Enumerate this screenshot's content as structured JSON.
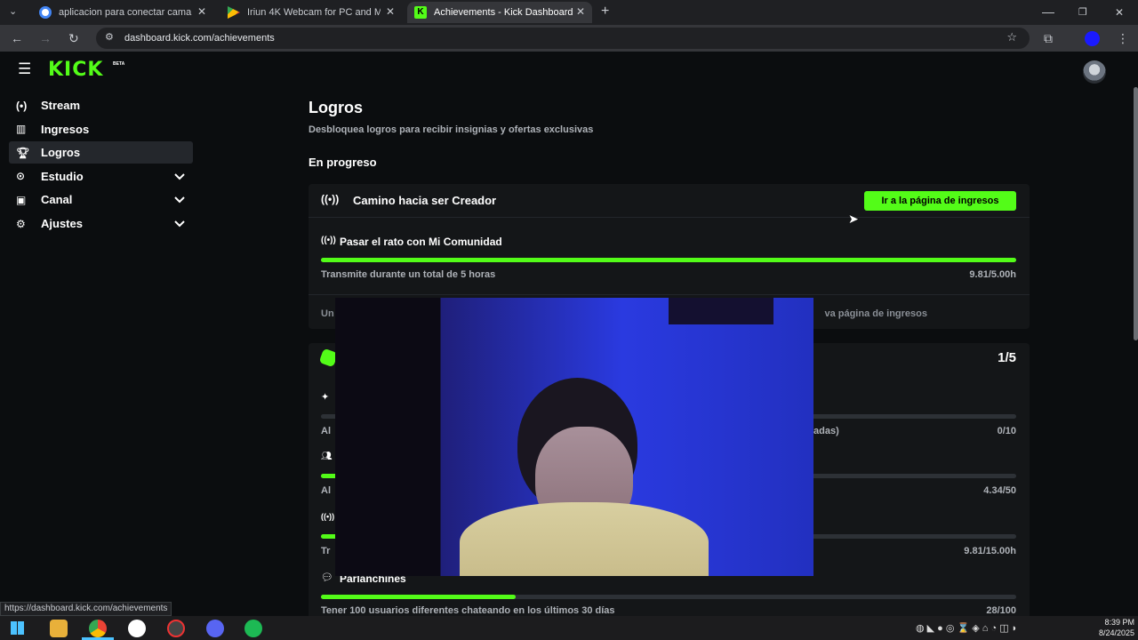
{
  "browser": {
    "tabs": [
      {
        "title": "aplicacion para conectar camar",
        "favicon_color": "#4285f4"
      },
      {
        "title": "Iriun 4K Webcam for PC and Ma",
        "favicon_color": "#ea4335"
      },
      {
        "title": "Achievements - Kick Dashboard",
        "favicon_color": "#53fc18"
      }
    ],
    "url": "dashboard.kick.com/achievements",
    "status_url": "https://dashboard.kick.com/achievements"
  },
  "app": {
    "logo": "KICK",
    "logo_badge": "BETA",
    "sidebar": [
      {
        "label": "Stream",
        "icon": "broadcast-icon",
        "glyph": "(•)",
        "active": false,
        "expandable": false
      },
      {
        "label": "Ingresos",
        "icon": "chart-icon",
        "glyph": "▥",
        "active": false,
        "expandable": false
      },
      {
        "label": "Logros",
        "icon": "trophy-icon",
        "glyph": "🏆︎",
        "active": true,
        "expandable": false
      },
      {
        "label": "Estudio",
        "icon": "studio-icon",
        "glyph": "⊙",
        "active": false,
        "expandable": true
      },
      {
        "label": "Canal",
        "icon": "channel-icon",
        "glyph": "▣",
        "active": false,
        "expandable": true
      },
      {
        "label": "Ajustes",
        "icon": "gear-icon",
        "glyph": "⚙",
        "active": false,
        "expandable": true
      }
    ],
    "page_title": "Logros",
    "page_subtitle": "Desbloquea logros para recibir insignias y ofertas exclusivas",
    "section_title": "En progreso",
    "card1": {
      "title": "Camino hacia ser Creador",
      "button": "Ir a la página de ingresos",
      "task_title": "Pasar el rato con Mi Comunidad",
      "task_desc": "Transmite durante un total de 5 horas",
      "task_value": "9.81/5.00h",
      "task_progress": 1.0,
      "footer_left": "Un",
      "footer_right": "va página de ingresos"
    },
    "card2": {
      "count": "1/5",
      "rows": [
        {
          "prefix": "Al",
          "desc_tail": "adas)",
          "value": "0/10",
          "progress": 0.0
        },
        {
          "prefix": "Al",
          "desc_tail": "",
          "value": "4.34/50",
          "progress": 0.087
        },
        {
          "prefix": "Tr",
          "desc_tail": "",
          "value": "9.81/15.00h",
          "progress": 0.654
        }
      ],
      "last_title": "Parlanchines",
      "last_desc": "Tener 100 usuarios diferentes chateando en los últimos 30 días",
      "last_value": "28/100",
      "last_progress": 0.28
    }
  },
  "taskbar": {
    "time": "8:39 PM",
    "date": "8/24/2025"
  },
  "colors": {
    "accent": "#53fc18",
    "background": "#0b0d0f",
    "card": "#141618"
  }
}
